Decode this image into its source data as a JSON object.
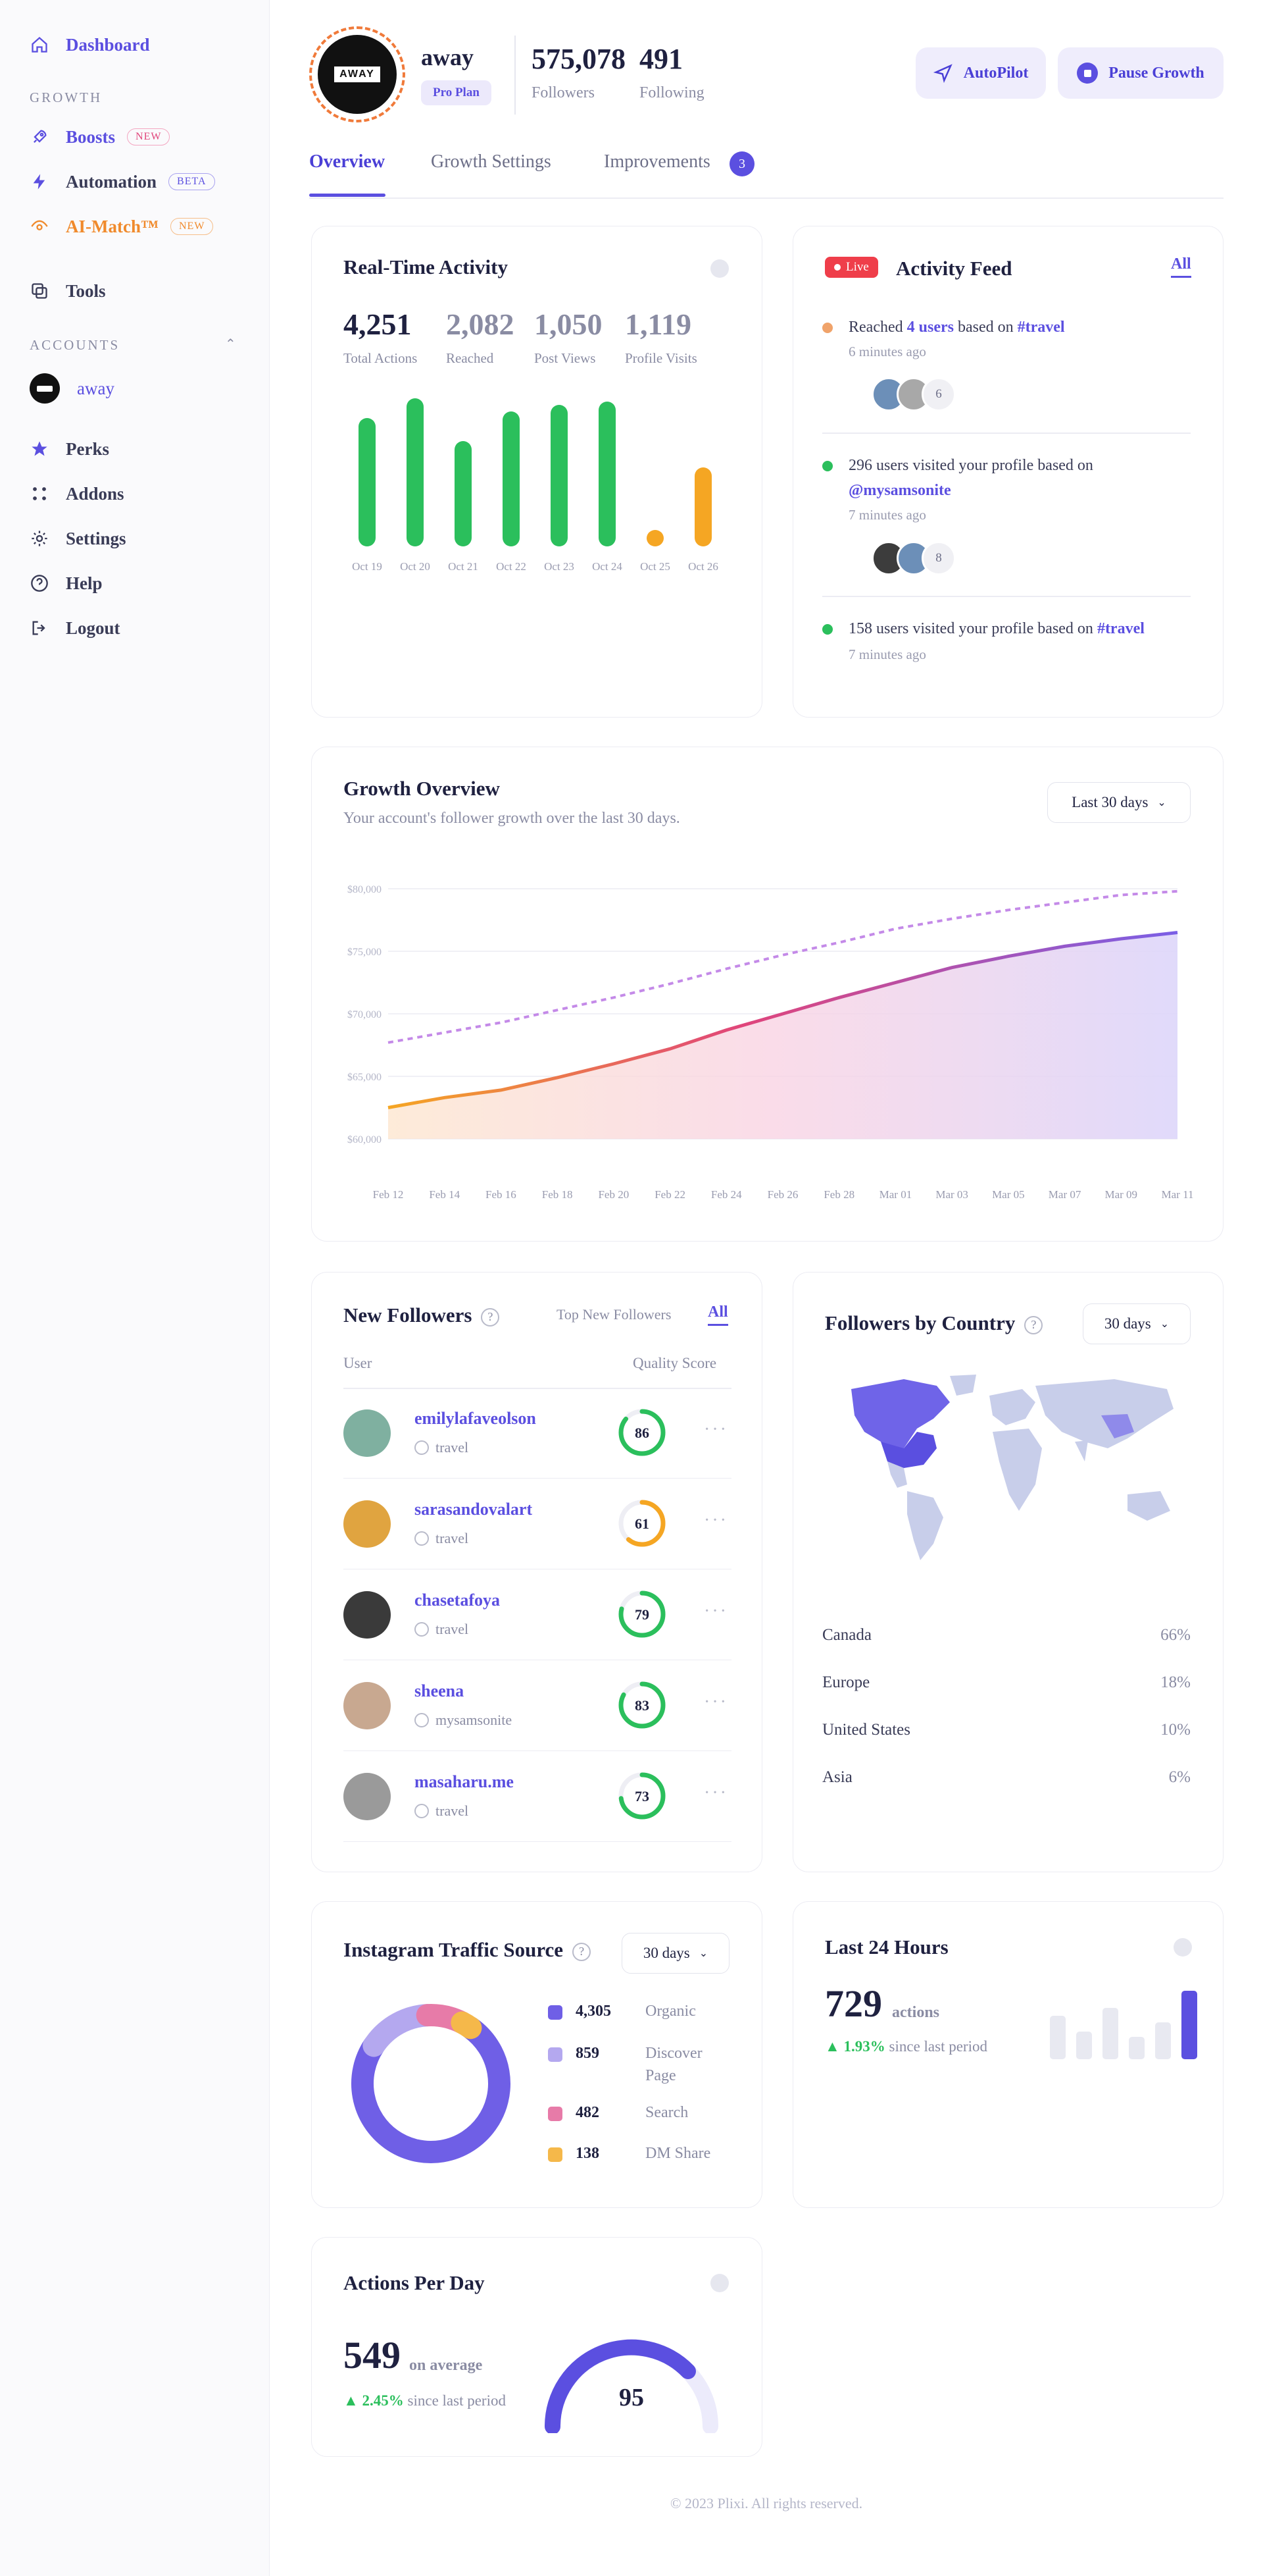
{
  "sidebar": {
    "dashboard": "Dashboard",
    "growth_section": "GROWTH",
    "boosts": "Boosts",
    "boosts_badge": "NEW",
    "automation": "Automation",
    "automation_badge": "BETA",
    "aimatch": "AI-Match™",
    "aimatch_badge": "NEW",
    "tools": "Tools",
    "accounts_section": "ACCOUNTS",
    "account_name": "away",
    "perks": "Perks",
    "addons": "Addons",
    "settings": "Settings",
    "help": "Help",
    "logout": "Logout"
  },
  "header": {
    "avatar_text": "AWAY",
    "username": "away",
    "plan": "Pro Plan",
    "followers_value": "575,078",
    "followers_label": "Followers",
    "following_value": "491",
    "following_label": "Following",
    "autopilot": "AutoPilot",
    "pause": "Pause Growth"
  },
  "tabs": [
    {
      "label": "Overview"
    },
    {
      "label": "Growth Settings"
    },
    {
      "label": "Improvements",
      "count": "3"
    }
  ],
  "realtime": {
    "title": "Real-Time Activity",
    "stats": [
      {
        "value": "4,251",
        "label": "Total Actions"
      },
      {
        "value": "2,082",
        "label": "Reached"
      },
      {
        "value": "1,050",
        "label": "Post Views"
      },
      {
        "value": "1,119",
        "label": "Profile Visits"
      }
    ]
  },
  "activity_feed": {
    "live": "Live",
    "title": "Activity Feed",
    "all": "All",
    "items": [
      {
        "pre": "Reached ",
        "highlight": "4 users",
        "mid": " based on ",
        "tag": "#travel",
        "time": "6 minutes ago",
        "more": "6",
        "dot": "#f0a36a"
      },
      {
        "pre": "296 users visited your profile based on ",
        "tag": "@mysamsonite",
        "time": "7 minutes ago",
        "more": "8",
        "dot": "#2bbf5c"
      },
      {
        "pre": "158 users visited your profile based on ",
        "tag": "#travel",
        "time": "7 minutes ago",
        "dot": "#2bbf5c"
      }
    ]
  },
  "growth": {
    "title": "Growth Overview",
    "subtitle": "Your account's follower growth over the last 30 days.",
    "range": "Last 30 days"
  },
  "new_followers": {
    "title": "New Followers",
    "filter_top": "Top New Followers",
    "filter_all": "All",
    "col_user": "User",
    "col_score": "Quality Score",
    "rows": [
      {
        "name": "emilylafaveolson",
        "tag": "travel",
        "score": "86",
        "color": "#2bbf5c",
        "av": "#7fb0a0"
      },
      {
        "name": "sarasandovalart",
        "tag": "travel",
        "score": "61",
        "color": "#f5a623",
        "av": "#e0a440"
      },
      {
        "name": "chasetafoya",
        "tag": "travel",
        "score": "79",
        "color": "#2bbf5c",
        "av": "#3a3a3a"
      },
      {
        "name": "sheena",
        "tag": "mysamsonite",
        "score": "83",
        "color": "#2bbf5c",
        "av": "#c8a890"
      },
      {
        "name": "masaharu.me",
        "tag": "travel",
        "score": "73",
        "color": "#2bbf5c",
        "av": "#9a9a9a"
      }
    ]
  },
  "countries": {
    "title": "Followers by Country",
    "range": "30 days",
    "rows": [
      {
        "name": "Canada",
        "pct": "66%"
      },
      {
        "name": "Europe",
        "pct": "18%"
      },
      {
        "name": "United States",
        "pct": "10%"
      },
      {
        "name": "Asia",
        "pct": "6%"
      }
    ]
  },
  "traffic": {
    "title": "Instagram Traffic Source",
    "range": "30 days",
    "items": [
      {
        "value": "4,305",
        "label": "Organic",
        "color": "#6f5fe6"
      },
      {
        "value": "859",
        "label": "Discover Page",
        "color": "#b4a8ef"
      },
      {
        "value": "482",
        "label": "Search",
        "color": "#e77ba8"
      },
      {
        "value": "138",
        "label": "DM Share",
        "color": "#f5b84a"
      }
    ]
  },
  "last24": {
    "title": "Last 24 Hours",
    "value": "729",
    "unit": "actions",
    "change": "▲ 1.93%",
    "since": "since last period"
  },
  "apd": {
    "title": "Actions Per Day",
    "value": "549",
    "unit": "on average",
    "change": "▲ 2.45%",
    "since": "since last period",
    "gauge": "95"
  },
  "footer": "© 2023 Plixi. All rights reserved.",
  "chart_data": [
    {
      "type": "bar",
      "categories": [
        "Oct 19",
        "Oct 20",
        "Oct 21",
        "Oct 22",
        "Oct 23",
        "Oct 24",
        "Oct 25",
        "Oct 26"
      ],
      "values": [
        195,
        225,
        160,
        205,
        215,
        220,
        25,
        120
      ],
      "colors": [
        "#2bbf5c",
        "#2bbf5c",
        "#2bbf5c",
        "#2bbf5c",
        "#2bbf5c",
        "#2bbf5c",
        "#f5a623",
        "#f5a623"
      ],
      "ylim": [
        0,
        230
      ]
    },
    {
      "type": "line",
      "x": [
        "Feb 12",
        "Feb 14",
        "Feb 16",
        "Feb 18",
        "Feb 20",
        "Feb 22",
        "Feb 24",
        "Feb 26",
        "Feb 28",
        "Mar 01",
        "Mar 03",
        "Mar 05",
        "Mar 07",
        "Mar 09",
        "Mar 11"
      ],
      "yticks": [
        "$60,000",
        "$65,000",
        "$70,000",
        "$75,000",
        "$80,000"
      ],
      "ylim": [
        60000,
        80000
      ],
      "series": [
        {
          "style": "solid",
          "values": [
            62500,
            63300,
            63900,
            64900,
            66000,
            67200,
            68700,
            70000,
            71300,
            72500,
            73700,
            74600,
            75400,
            76000,
            76500
          ]
        },
        {
          "style": "dashed",
          "values": [
            67700,
            68500,
            69300,
            70300,
            71300,
            72400,
            73600,
            74700,
            75700,
            76800,
            77600,
            78300,
            78900,
            79500,
            79800
          ]
        }
      ]
    }
  ]
}
